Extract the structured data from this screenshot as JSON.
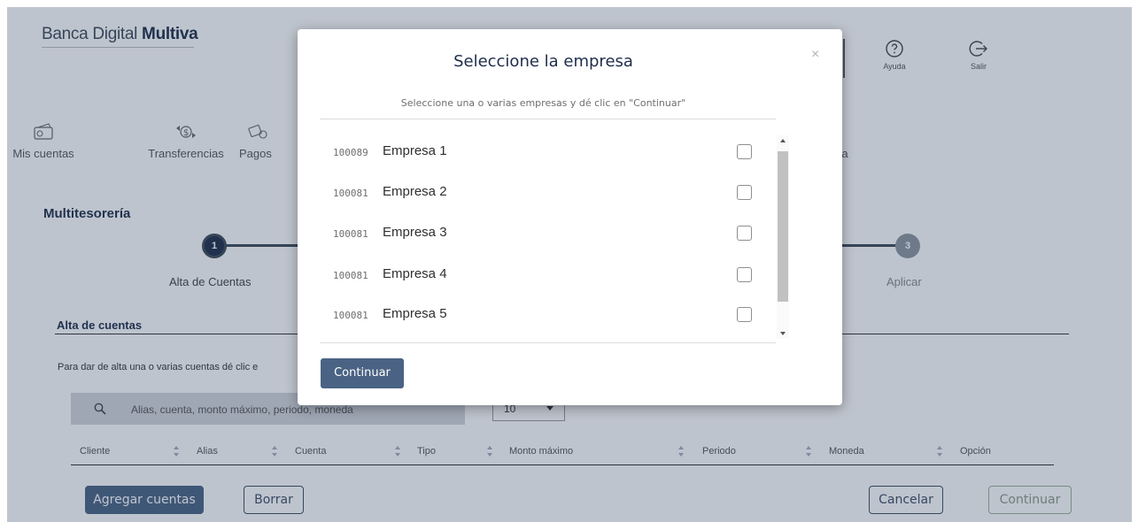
{
  "brand": {
    "prefix": "Banca Digital",
    "name": "Multiva"
  },
  "header_actions": [
    {
      "label": "Ayuda",
      "icon": "question-circle-icon"
    },
    {
      "label": "Salir",
      "icon": "logout-icon"
    }
  ],
  "nav": [
    {
      "label": "Mis cuentas",
      "icon": "wallet-icon"
    },
    {
      "label": "Transferencias",
      "icon": "money-transfer-icon"
    },
    {
      "label": "Pagos",
      "icon": "payments-icon"
    },
    {
      "label": "a",
      "icon": ""
    }
  ],
  "section_title": "Multitesorería",
  "stepper": {
    "steps": [
      {
        "number": "1",
        "label": "Alta de Cuentas",
        "state": "active"
      },
      {
        "number": "3",
        "label": "Aplicar",
        "state": "inactive"
      }
    ]
  },
  "alta": {
    "title": "Alta de cuentas",
    "instructions": "Para dar de alta una o varias cuentas dé clic e"
  },
  "search": {
    "placeholder": "Alias, cuenta, monto máximo, periodo, moneda",
    "icon": "search-icon"
  },
  "per_page": "10",
  "table": {
    "columns": [
      "Cliente",
      "Alias",
      "Cuenta",
      "Tipo",
      "Monto máximo",
      "Periodo",
      "Moneda",
      "Opción"
    ]
  },
  "actions": {
    "agregar": "Agregar cuentas",
    "borrar": "Borrar",
    "cancelar": "Cancelar",
    "continuar": "Continuar"
  },
  "modal": {
    "title": "Seleccione la empresa",
    "close": "×",
    "subtitle": "Seleccione una o varias empresas y dé clic en \"Continuar\"",
    "companies": [
      {
        "code": "100089",
        "name": "Empresa 1",
        "checked": false
      },
      {
        "code": "100081",
        "name": "Empresa 2",
        "checked": false
      },
      {
        "code": "100081",
        "name": "Empresa 3",
        "checked": false
      },
      {
        "code": "100081",
        "name": "Empresa 4",
        "checked": false
      },
      {
        "code": "100081",
        "name": "Empresa 5",
        "checked": false
      }
    ],
    "continue_label": "Continuar"
  },
  "colors": {
    "primary": "#4a6384",
    "navy": "#1e2d4a",
    "overlay": "rgba(40,60,90,0.30)"
  }
}
